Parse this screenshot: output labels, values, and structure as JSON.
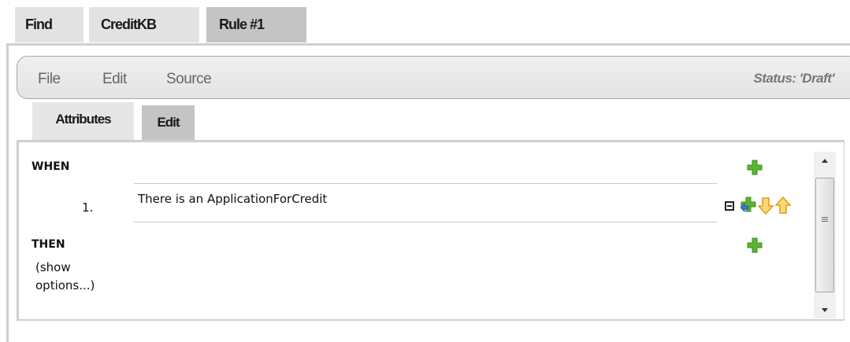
{
  "top_tabs": [
    {
      "label": "Find"
    },
    {
      "label": "CreditKB"
    },
    {
      "label": "Rule #1"
    }
  ],
  "menu": {
    "file": "File",
    "edit": "Edit",
    "source": "Source",
    "status": "Status: 'Draft'"
  },
  "sub_tabs": [
    {
      "label": "Attributes"
    },
    {
      "label": "Edit"
    }
  ],
  "rule": {
    "when_label": "WHEN",
    "condition_number": "1.",
    "condition_text": "There is an ApplicationForCredit",
    "then_label": "THEN",
    "show_options_line1": "(show",
    "show_options_line2": "options...)"
  },
  "colors": {
    "active_tab": "#c4c4c4",
    "inactive_tab": "#e2e2e2",
    "add_icon": "#5bb531",
    "arrow_icon": "#f0a21a"
  },
  "icons": {
    "add": "plus-icon",
    "insert": "insert-plus-arrow-icon",
    "move_down": "arrow-down-icon",
    "move_up": "arrow-up-icon",
    "remove": "remove-square-icon"
  }
}
